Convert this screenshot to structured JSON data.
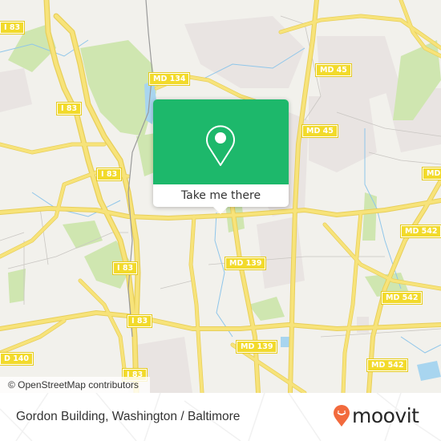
{
  "map": {
    "colors": {
      "background": "#f2f1ec",
      "road": "#f7e37a",
      "road_casing": "#e8cf5a",
      "park": "#cfe6b0",
      "water": "#a8d5ef",
      "urban": "#e9e4e2",
      "minor_road": "#c9c6c2"
    },
    "shields": [
      {
        "id": "i83-topleft",
        "label": "I 83"
      },
      {
        "id": "i83-1",
        "label": "I 83"
      },
      {
        "id": "md134",
        "label": "MD 134"
      },
      {
        "id": "md45-1",
        "label": "MD 45"
      },
      {
        "id": "md45-2",
        "label": "MD 45"
      },
      {
        "id": "md-right",
        "label": "MD"
      },
      {
        "id": "i83-2",
        "label": "I 83"
      },
      {
        "id": "i83-3",
        "label": "I 83"
      },
      {
        "id": "i83-4",
        "label": "I 83"
      },
      {
        "id": "i83-5",
        "label": "I 83"
      },
      {
        "id": "md542-1",
        "label": "MD 542"
      },
      {
        "id": "md542-2",
        "label": "MD 542"
      },
      {
        "id": "md542-3",
        "label": "MD 542"
      },
      {
        "id": "md139-1",
        "label": "MD 139"
      },
      {
        "id": "md139-2",
        "label": "MD 139"
      },
      {
        "id": "md140",
        "label": "D 140"
      }
    ],
    "attribution": "© OpenStreetMap contributors"
  },
  "popup": {
    "icon": "map-pin-icon",
    "accent": "#1db86b",
    "cta_label": "Take me there"
  },
  "footer": {
    "place_name": "Gordon Building, Washington / Baltimore",
    "brand": {
      "name": "moovit",
      "icon": "moovit-pin-icon",
      "accent": "#f26a3d"
    }
  }
}
